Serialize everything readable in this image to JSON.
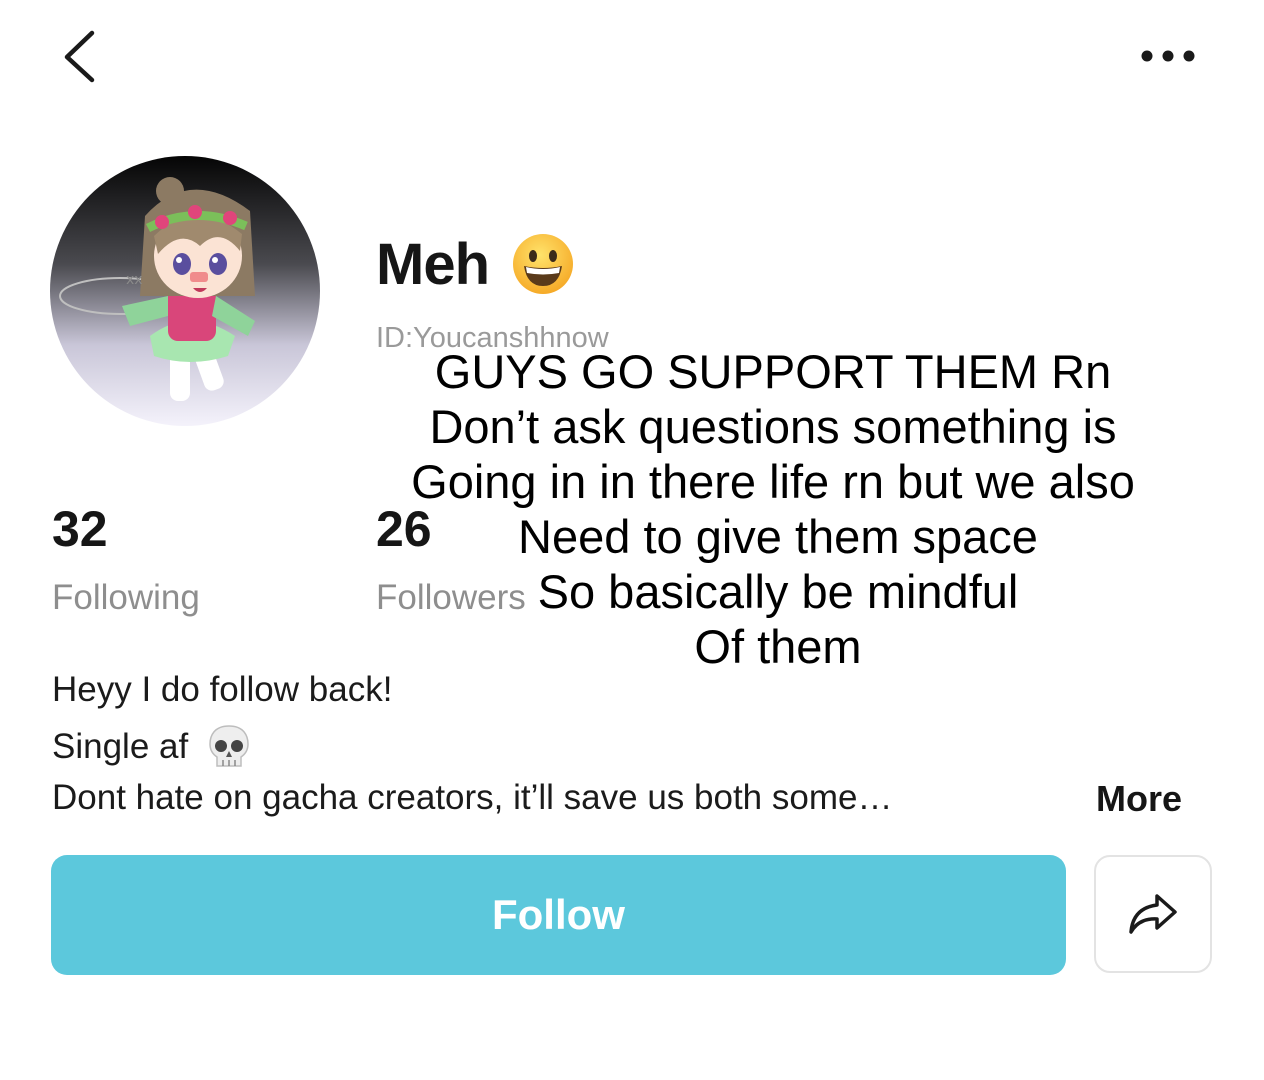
{
  "header": {
    "back_icon": "chevron-left-icon",
    "more_icon": "more-horizontal-icon"
  },
  "profile": {
    "name": "Meh",
    "name_emoji": "grinning-face-emoji",
    "user_id": "ID:Youcanshhnow"
  },
  "stats": {
    "following_count": "32",
    "following_label": "Following",
    "followers_count": "26",
    "followers_label": "Followers"
  },
  "bio": {
    "line1": "Heyy  I do follow back!",
    "line2": "Single af",
    "line2_emoji": "skull-emoji",
    "line3": "Dont hate on gacha creators, it’ll save us both some…",
    "more_label": "More"
  },
  "actions": {
    "follow_label": "Follow",
    "share_icon": "share-arrow-icon"
  },
  "overlay_caption": [
    "GUYS GO SUPPORT THEM Rn",
    "Don’t ask questions something is",
    "Going in in there life rn but we also",
    "Need to give them space",
    "So basically be mindful",
    "Of them"
  ],
  "colors": {
    "follow_button": "#5cc8dc",
    "secondary_text": "#8e8e8e"
  }
}
